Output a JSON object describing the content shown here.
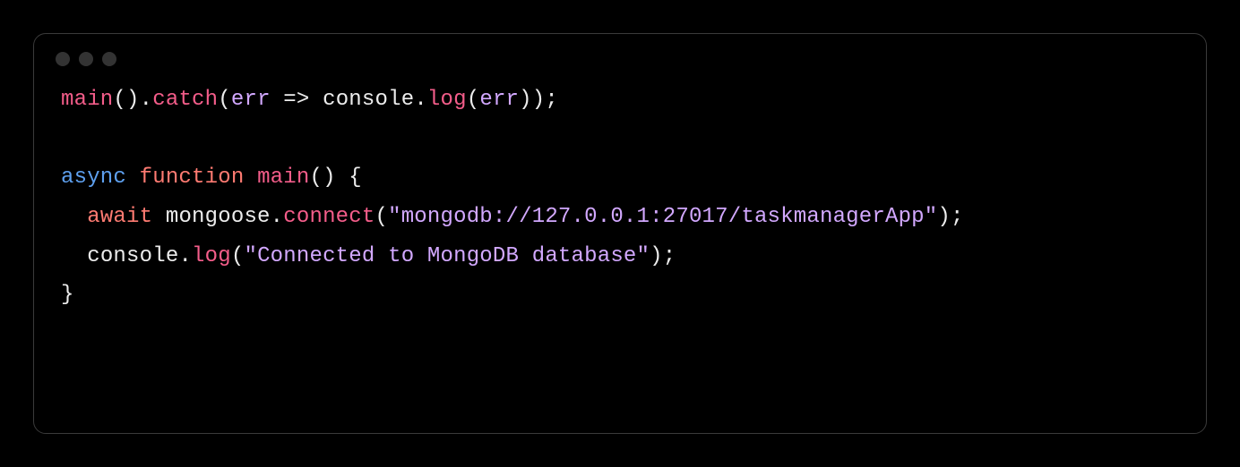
{
  "code": {
    "line1": {
      "t1": "main",
      "t2": "().",
      "t3": "catch",
      "t4": "(",
      "t5": "err",
      "t6": " => ",
      "t7": "console",
      "t8": ".",
      "t9": "log",
      "t10": "(",
      "t11": "err",
      "t12": "));"
    },
    "line3": {
      "t1": "async",
      "t2": " ",
      "t3": "function",
      "t4": " ",
      "t5": "main",
      "t6": "() {"
    },
    "line4": {
      "indent": "  ",
      "t1": "await",
      "t2": " mongoose.",
      "t3": "connect",
      "t4": "(",
      "t5": "\"mongodb://127.0.0.1:27017/taskmanagerApp\"",
      "t6": ");"
    },
    "line5": {
      "indent": "  ",
      "t1": "console",
      "t2": ".",
      "t3": "log",
      "t4": "(",
      "t5": "\"Connected to MongoDB database\"",
      "t6": ");"
    },
    "line6": {
      "t1": "}"
    }
  }
}
